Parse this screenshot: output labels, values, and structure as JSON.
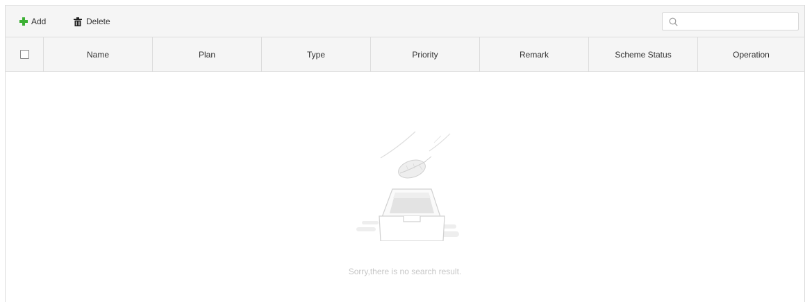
{
  "toolbar": {
    "add_label": "Add",
    "delete_label": "Delete",
    "search_placeholder": "",
    "search_value": "",
    "accent_color": "#3cb034"
  },
  "table": {
    "columns": [
      "Name",
      "Plan",
      "Type",
      "Priority",
      "Remark",
      "Scheme Status",
      "Operation"
    ],
    "rows": []
  },
  "empty": {
    "message": "Sorry,there is no search result."
  },
  "icons": {
    "add": "plus-icon",
    "delete": "trash-icon",
    "search": "search-icon",
    "empty": "empty-box-illustration"
  }
}
